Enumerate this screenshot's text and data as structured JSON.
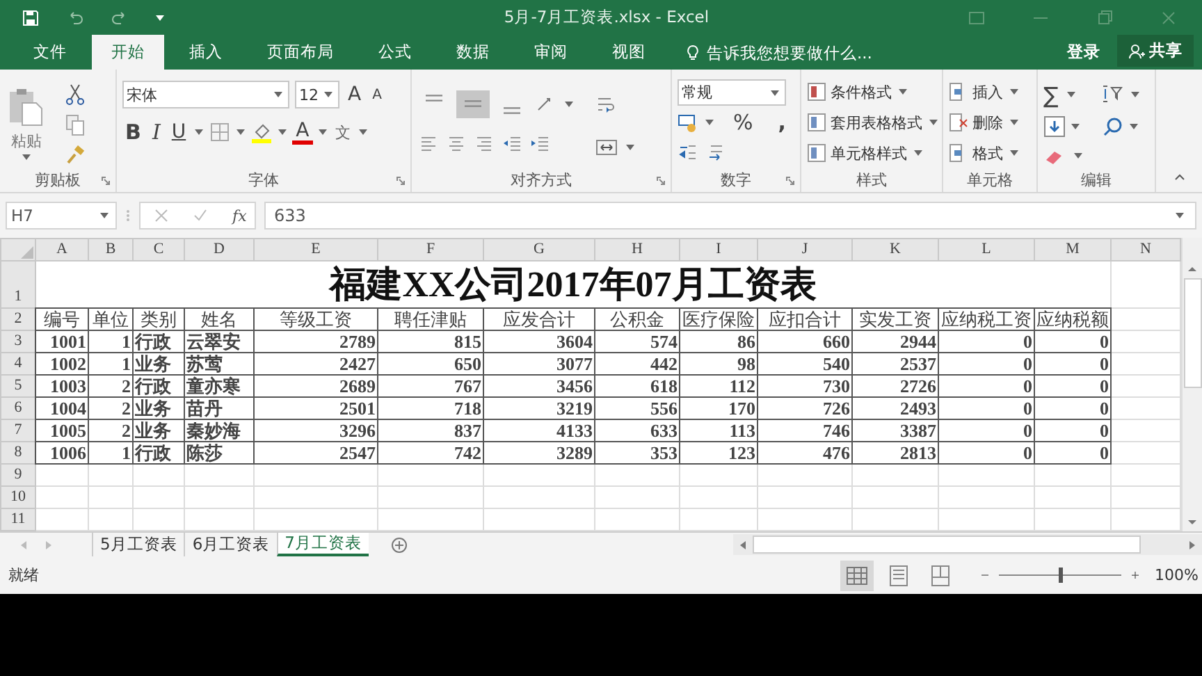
{
  "window": {
    "title": "5月-7月工资表.xlsx - Excel"
  },
  "tabs": [
    {
      "label": "文件",
      "selected": false
    },
    {
      "label": "开始",
      "selected": true
    },
    {
      "label": "插入",
      "selected": false
    },
    {
      "label": "页面布局",
      "selected": false
    },
    {
      "label": "公式",
      "selected": false
    },
    {
      "label": "数据",
      "selected": false
    },
    {
      "label": "审阅",
      "selected": false
    },
    {
      "label": "视图",
      "selected": false
    }
  ],
  "tell_me": {
    "placeholder": "告诉我您想要做什么..."
  },
  "account": {
    "sign_in": "登录",
    "share": "共享"
  },
  "ribbon": {
    "clipboard": {
      "label": "剪贴板",
      "paste": "粘贴"
    },
    "font": {
      "label": "字体",
      "font_name": "宋体",
      "font_size": "12",
      "grow": "A",
      "shrink": "A",
      "bold": "B",
      "italic": "I",
      "underline": "U",
      "font_color": "A",
      "phonetic": "文"
    },
    "alignment": {
      "label": "对齐方式",
      "vertical": [
        {
          "kind": "top",
          "selected": false
        },
        {
          "kind": "middle",
          "selected": true
        },
        {
          "kind": "bottom",
          "selected": false
        }
      ]
    },
    "number": {
      "label": "数字",
      "format": "常规",
      "percent": "%",
      "comma": ","
    },
    "styles": {
      "label": "样式",
      "items": [
        "条件格式",
        "套用表格格式",
        "单元格样式"
      ]
    },
    "cells": {
      "label": "单元格",
      "items": [
        "插入",
        "删除",
        "格式"
      ]
    },
    "editing": {
      "label": "编辑",
      "sum": "∑"
    }
  },
  "formula_bar": {
    "name_box": "H7",
    "fx": "fx",
    "formula": "633"
  },
  "sheet": {
    "columns": [
      {
        "letter": "A",
        "kind": "number"
      },
      {
        "letter": "B",
        "kind": "number"
      },
      {
        "letter": "C",
        "kind": "text"
      },
      {
        "letter": "D",
        "kind": "text"
      },
      {
        "letter": "E",
        "kind": "number"
      },
      {
        "letter": "F",
        "kind": "number"
      },
      {
        "letter": "G",
        "kind": "number"
      },
      {
        "letter": "H",
        "kind": "number"
      },
      {
        "letter": "I",
        "kind": "number"
      },
      {
        "letter": "J",
        "kind": "number"
      },
      {
        "letter": "K",
        "kind": "number"
      },
      {
        "letter": "L",
        "kind": "number"
      },
      {
        "letter": "M",
        "kind": "number"
      },
      {
        "letter": "N"
      }
    ],
    "row_numbers": [
      "1",
      "2",
      "3",
      "4",
      "5",
      "6",
      "7",
      "8",
      "9",
      "10",
      "11"
    ],
    "title": "福建XX公司2017年07月工资表",
    "header": [
      "编号",
      "单位",
      "类别",
      "姓名",
      "等级工资",
      "聘任津贴",
      "应发合计",
      "公积金",
      "医疗保险",
      "应扣合计",
      "实发工资",
      "应纳税工资",
      "应纳税额"
    ],
    "rows": [
      [
        "1001",
        "1",
        "行政",
        "云翠安",
        "2789",
        "815",
        "3604",
        "574",
        "86",
        "660",
        "2944",
        "0",
        "0"
      ],
      [
        "1002",
        "1",
        "业务",
        "苏莺",
        "2427",
        "650",
        "3077",
        "442",
        "98",
        "540",
        "2537",
        "0",
        "0"
      ],
      [
        "1003",
        "2",
        "行政",
        "童亦寒",
        "2689",
        "767",
        "3456",
        "618",
        "112",
        "730",
        "2726",
        "0",
        "0"
      ],
      [
        "1004",
        "2",
        "业务",
        "苗丹",
        "2501",
        "718",
        "3219",
        "556",
        "170",
        "726",
        "2493",
        "0",
        "0"
      ],
      [
        "1005",
        "2",
        "业务",
        "秦妙海",
        "3296",
        "837",
        "4133",
        "633",
        "113",
        "746",
        "3387",
        "0",
        "0"
      ],
      [
        "1006",
        "1",
        "行政",
        "陈莎",
        "2547",
        "742",
        "3289",
        "353",
        "123",
        "476",
        "2813",
        "0",
        "0"
      ]
    ]
  },
  "sheet_tabs": [
    {
      "label": "5月工资表",
      "selected": false
    },
    {
      "label": "6月工资表",
      "selected": false
    },
    {
      "label": "7月工资表",
      "selected": true
    }
  ],
  "status_bar": {
    "status": "就绪",
    "zoom": "100%",
    "zoom_slider": {
      "level": 0.5
    }
  }
}
